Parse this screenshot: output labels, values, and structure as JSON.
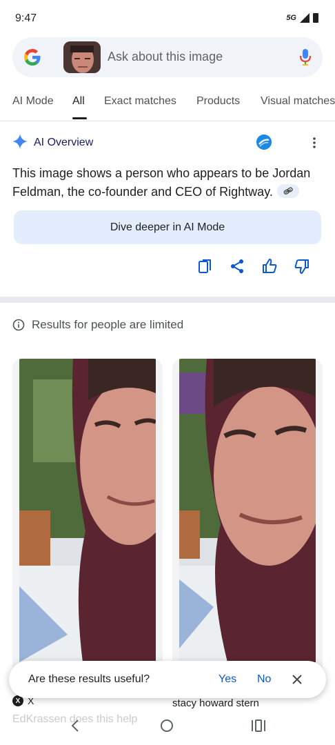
{
  "status": {
    "time": "9:47",
    "network": "5G"
  },
  "search": {
    "placeholder": "Ask about this image"
  },
  "tabs": [
    {
      "label": "AI Mode"
    },
    {
      "label": "All"
    },
    {
      "label": "Exact matches"
    },
    {
      "label": "Products"
    },
    {
      "label": "Visual matches"
    }
  ],
  "overview": {
    "title": "AI Overview",
    "text": "This image shows a person who appears to be Jordan Feldman, the co-founder and CEO of Rightway.",
    "dive_label": "Dive deeper in AI Mode"
  },
  "notice": {
    "text": "Results for people are limited"
  },
  "results": [
    {
      "source": "X",
      "title": "EdKrassen does this help"
    },
    {
      "title": "stacy howard stern"
    }
  ],
  "feedback": {
    "question": "Are these results useful?",
    "yes": "Yes",
    "no": "No"
  },
  "colors": {
    "accent": "#0b57d0",
    "dive_bg": "#e3edfd",
    "search_bg": "#f0f4f8"
  }
}
